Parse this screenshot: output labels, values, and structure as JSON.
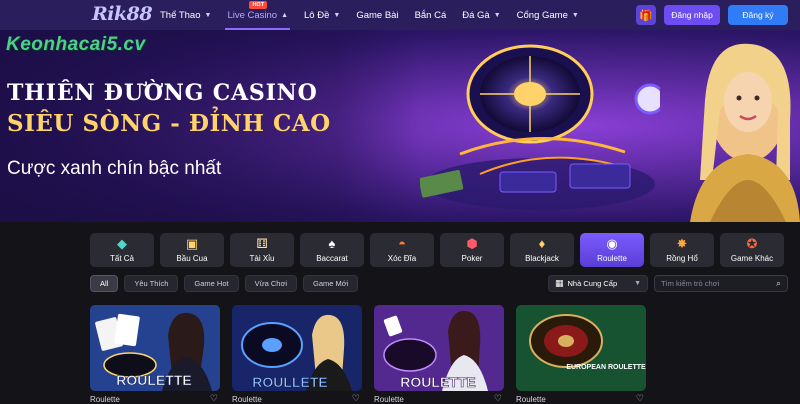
{
  "header": {
    "logo_text": "Rik88",
    "nav": [
      {
        "label": "Thể Thao",
        "has_dropdown": true,
        "active": false
      },
      {
        "label": "Live Casino",
        "has_dropdown": true,
        "active": true,
        "badge": "HOT"
      },
      {
        "label": "Lô Đề",
        "has_dropdown": true,
        "active": false
      },
      {
        "label": "Game Bài",
        "has_dropdown": false,
        "active": false
      },
      {
        "label": "Bắn Cá",
        "has_dropdown": false,
        "active": false
      },
      {
        "label": "Đá Gà",
        "has_dropdown": true,
        "active": false
      },
      {
        "label": "Cổng Game",
        "has_dropdown": true,
        "active": false
      }
    ],
    "gift_icon": "gift-icon",
    "login_label": "Đăng nhập",
    "register_label": "Đăng ký"
  },
  "hero": {
    "watermark": "Keonhacai5.cv",
    "title_line1": "THIÊN ĐƯỜNG CASINO",
    "title_line2": "SIÊU SÒNG - ĐỈNH CAO",
    "tagline": "Cược xanh chín bậc nhất"
  },
  "categories": [
    {
      "label": "Tất Cả",
      "icon": "diamond-icon",
      "active": false
    },
    {
      "label": "Bầu Cua",
      "icon": "dice-block-icon",
      "active": false
    },
    {
      "label": "Tài Xỉu",
      "icon": "dice-icon",
      "active": false
    },
    {
      "label": "Baccarat",
      "icon": "cards-icon",
      "active": false
    },
    {
      "label": "Xóc Đĩa",
      "icon": "bowl-icon",
      "active": false
    },
    {
      "label": "Poker",
      "icon": "poker-chip-icon",
      "active": false
    },
    {
      "label": "Blackjack",
      "icon": "card-icon",
      "active": false
    },
    {
      "label": "Roulette",
      "icon": "roulette-icon",
      "active": true
    },
    {
      "label": "Rồng Hổ",
      "icon": "tiger-icon",
      "active": false
    },
    {
      "label": "Game Khác",
      "icon": "mascot-icon",
      "active": false
    }
  ],
  "filters": {
    "chips": [
      {
        "label": "All",
        "active": true
      },
      {
        "label": "Yêu Thích",
        "active": false
      },
      {
        "label": "Game Hot",
        "active": false
      },
      {
        "label": "Vừa Chơi",
        "active": false
      },
      {
        "label": "Game Mới",
        "active": false
      }
    ],
    "provider_label": "Nhà Cung Cấp",
    "search_placeholder": "Tìm kiếm trò chơi"
  },
  "games": [
    {
      "name": "Roulette",
      "thumb_text": "ROULETTE",
      "accent": "#3b6fd8"
    },
    {
      "name": "Roulette",
      "thumb_text": "ROULLETE",
      "accent": "#2a3fa8"
    },
    {
      "name": "Roulette",
      "thumb_text": "ROULETTE",
      "accent": "#7a3fc8"
    },
    {
      "name": "Roulette",
      "thumb_text": "EUROPEAN ROULETTE",
      "accent": "#1f6b3e"
    }
  ],
  "colors": {
    "topbar": "#2a1f5c",
    "accent_purple": "#6d4df2",
    "accent_blue": "#2f7cf6",
    "gold": "#ffd36a",
    "page_bg": "#141418"
  }
}
